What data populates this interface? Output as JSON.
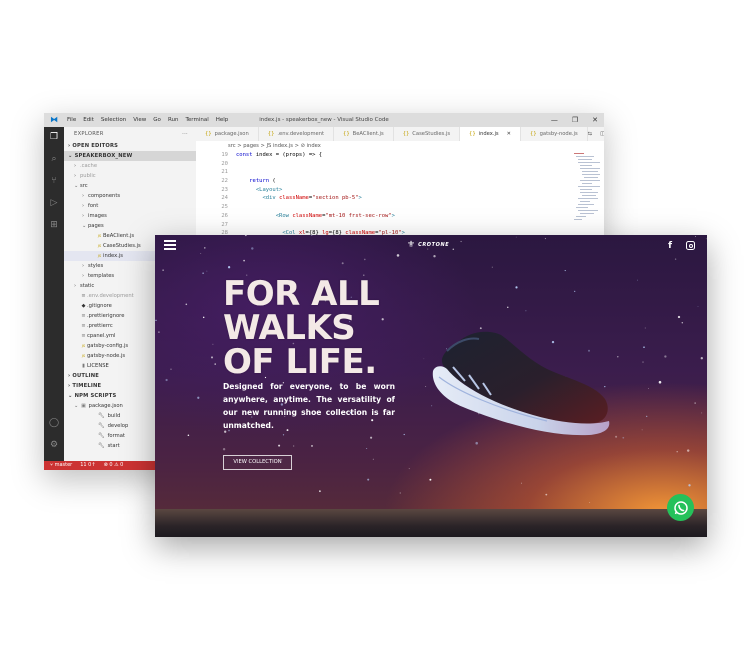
{
  "vscode": {
    "title": "index.js - speakerbox_new - Visual Studio Code",
    "menu": [
      "File",
      "Edit",
      "Selection",
      "View",
      "Go",
      "Run",
      "Terminal",
      "Help"
    ],
    "window_buttons": [
      "—",
      "❐",
      "✕"
    ],
    "sidebar": {
      "header": "EXPLORER",
      "header_more": "···",
      "open_editors": "OPEN EDITORS",
      "project": "SPEAKERBOX_NEW",
      "tree": [
        {
          "label": ".cache",
          "type": "folder",
          "depth": 0,
          "open": false,
          "dim": true
        },
        {
          "label": "public",
          "type": "folder",
          "depth": 0,
          "open": false,
          "dim": true
        },
        {
          "label": "src",
          "type": "folder",
          "depth": 0,
          "open": true,
          "dim": false
        },
        {
          "label": "components",
          "type": "folder",
          "depth": 1,
          "open": false,
          "dim": false
        },
        {
          "label": "font",
          "type": "folder",
          "depth": 1,
          "open": false,
          "dim": false
        },
        {
          "label": "images",
          "type": "folder",
          "depth": 1,
          "open": false,
          "dim": false
        },
        {
          "label": "pages",
          "type": "folder",
          "depth": 1,
          "open": true,
          "dim": false
        },
        {
          "label": "BeAClient.js",
          "type": "js",
          "depth": 2,
          "dim": false
        },
        {
          "label": "CaseStudies.js",
          "type": "js",
          "depth": 2,
          "dim": false
        },
        {
          "label": "index.js",
          "type": "js",
          "depth": 2,
          "dim": false,
          "selected": true
        },
        {
          "label": "styles",
          "type": "folder",
          "depth": 1,
          "open": false,
          "dim": false
        },
        {
          "label": "templates",
          "type": "folder",
          "depth": 1,
          "open": false,
          "dim": false
        },
        {
          "label": "static",
          "type": "folder",
          "depth": 0,
          "open": false,
          "dim": false
        },
        {
          "label": ".env.development",
          "type": "file",
          "depth": 0,
          "dim": true
        },
        {
          "label": ".gitignore",
          "type": "git",
          "depth": 0,
          "dim": false
        },
        {
          "label": ".prettierignore",
          "type": "file",
          "depth": 0,
          "dim": false
        },
        {
          "label": ".prettierrc",
          "type": "file",
          "depth": 0,
          "dim": false
        },
        {
          "label": "cpanel.yml",
          "type": "file",
          "depth": 0,
          "dim": false
        },
        {
          "label": "gatsby-config.js",
          "type": "js",
          "depth": 0,
          "dim": false
        },
        {
          "label": "gatsby-node.js",
          "type": "js",
          "depth": 0,
          "dim": false
        },
        {
          "label": "LICENSE",
          "type": "lic",
          "depth": 0,
          "dim": false
        }
      ],
      "outline": "OUTLINE",
      "timeline": "TIMELINE",
      "npm_scripts": "NPM SCRIPTS",
      "package_json": "package.json",
      "scripts": [
        "build",
        "develop",
        "format",
        "start"
      ]
    },
    "tabs": [
      {
        "label": "package.json",
        "active": false
      },
      {
        "label": ".env.development",
        "active": false
      },
      {
        "label": "BeAClient.js",
        "active": false
      },
      {
        "label": "CaseStudies.js",
        "active": false
      },
      {
        "label": "index.js",
        "active": true
      },
      {
        "label": "gatsby-node.js",
        "active": false
      }
    ],
    "breadcrumb": "src > pages > JS index.js > ⊘ index",
    "code": [
      {
        "n": "19",
        "parts": [
          [
            "kw",
            "const "
          ],
          [
            "txt",
            "index = (props) => {"
          ]
        ]
      },
      {
        "n": "20",
        "parts": []
      },
      {
        "n": "21",
        "parts": []
      },
      {
        "n": "22",
        "parts": [
          [
            "txt",
            "    "
          ],
          [
            "kw",
            "return"
          ],
          [
            "txt",
            " ("
          ]
        ]
      },
      {
        "n": "23",
        "parts": [
          [
            "txt",
            "      "
          ],
          [
            "tag",
            "<Layout>"
          ]
        ]
      },
      {
        "n": "24",
        "parts": [
          [
            "txt",
            "        "
          ],
          [
            "tag",
            "<div "
          ],
          [
            "attr",
            "className"
          ],
          [
            "txt",
            "="
          ],
          [
            "str",
            "\"section pb-5\""
          ],
          [
            "tag",
            ">"
          ]
        ]
      },
      {
        "n": "25",
        "parts": []
      },
      {
        "n": "26",
        "parts": [
          [
            "txt",
            "            "
          ],
          [
            "tag",
            "<Row "
          ],
          [
            "attr",
            "className"
          ],
          [
            "txt",
            "="
          ],
          [
            "str",
            "\"mt-10 frst-sec-row\""
          ],
          [
            "tag",
            ">"
          ]
        ]
      },
      {
        "n": "27",
        "parts": []
      },
      {
        "n": "28",
        "parts": [
          [
            "txt",
            "              "
          ],
          [
            "tag",
            "<Col "
          ],
          [
            "attr",
            "xl"
          ],
          [
            "txt",
            "={8} "
          ],
          [
            "attr",
            "lg"
          ],
          [
            "txt",
            "={8} "
          ],
          [
            "attr",
            "className"
          ],
          [
            "txt",
            "="
          ],
          [
            "str",
            "\"pl-10\""
          ],
          [
            "tag",
            ">"
          ]
        ]
      },
      {
        "n": "29",
        "parts": []
      }
    ],
    "status": {
      "branch": "master",
      "sync": "11 0↑",
      "problems": "⊗ 0 ⚠ 0"
    }
  },
  "site": {
    "brand": "CROTONE",
    "headline": [
      "FOR ALL",
      "WALKS",
      "OF LIFE."
    ],
    "blurb": "Designed for everyone, to be worn anywhere, anytime. The versatility of our new running shoe collection is far unmatched.",
    "cta": "VIEW COLLECTION",
    "social": {
      "facebook": "f"
    },
    "colors": {
      "whatsapp": "#25c15a",
      "cta_border": "#d8d0d6",
      "headline": "#f3e9e6"
    }
  }
}
